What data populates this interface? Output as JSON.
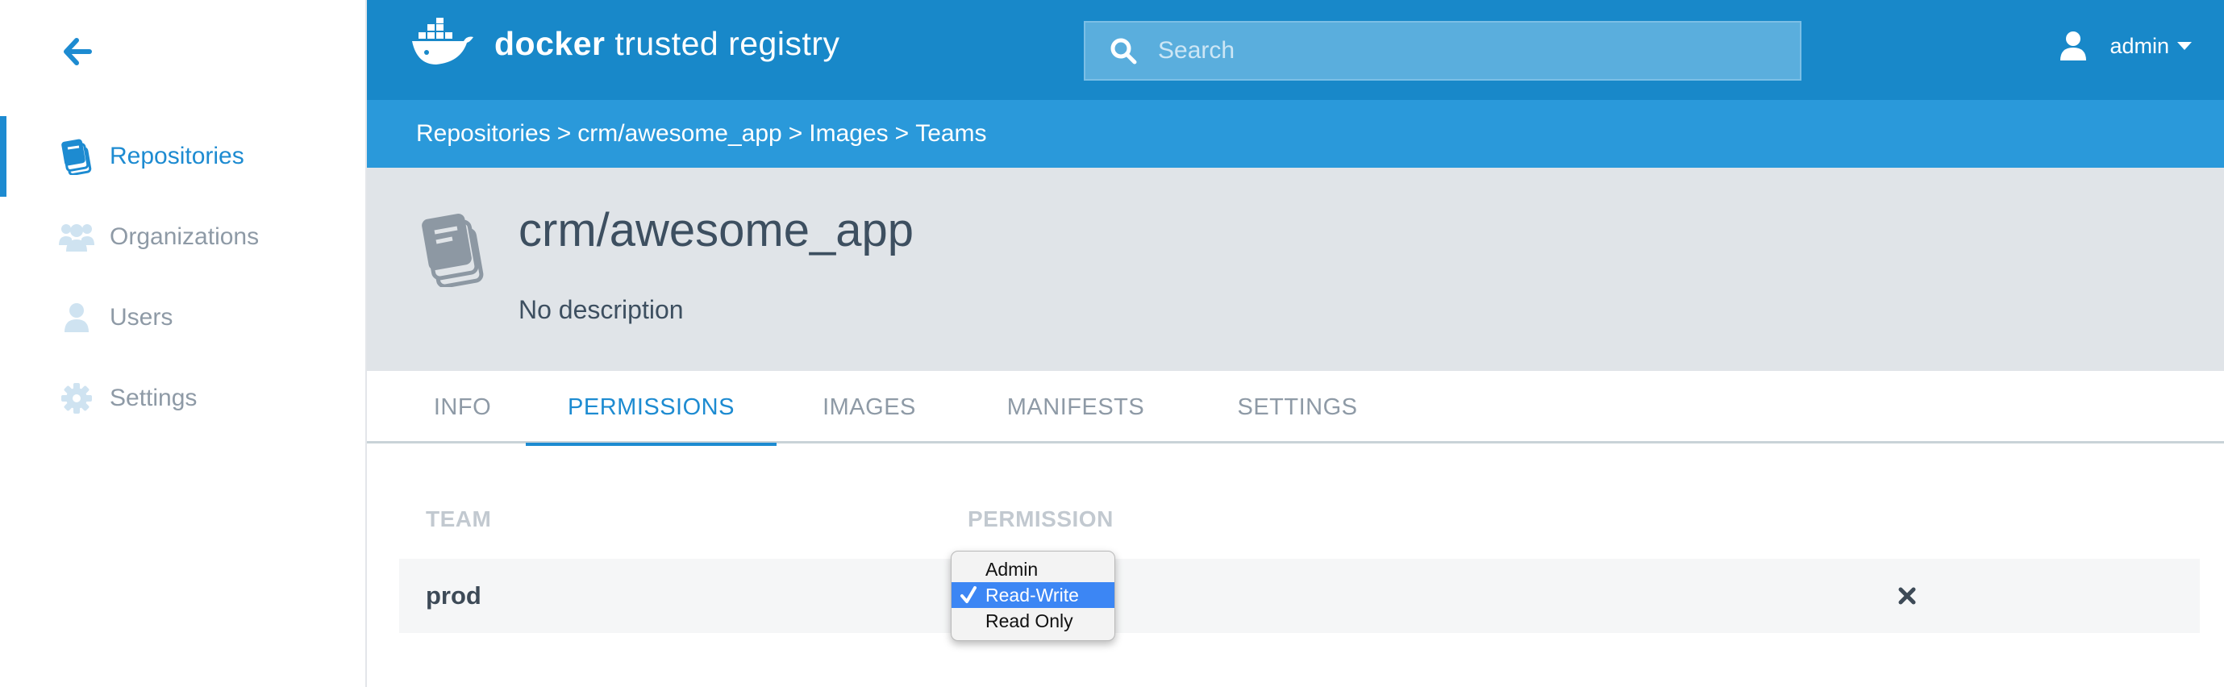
{
  "app": {
    "logo_word1": "docker",
    "logo_word2": "trusted registry"
  },
  "search": {
    "placeholder": "Search"
  },
  "user": {
    "name": "admin"
  },
  "sidebar": {
    "back_icon": "arrow-left-icon",
    "items": [
      {
        "label": "Repositories",
        "icon": "book-stack-icon",
        "active": true
      },
      {
        "label": "Organizations",
        "icon": "users-group-icon",
        "active": false
      },
      {
        "label": "Users",
        "icon": "user-icon",
        "active": false
      },
      {
        "label": "Settings",
        "icon": "gear-icon",
        "active": false
      }
    ]
  },
  "breadcrumb": [
    "Repositories",
    "crm/awesome_app",
    "Images",
    "Teams"
  ],
  "breadcrumb_separator": ">",
  "repo": {
    "title": "crm/awesome_app",
    "description": "No description"
  },
  "tabs": [
    {
      "label": "INFO",
      "active": false
    },
    {
      "label": "PERMISSIONS",
      "active": true
    },
    {
      "label": "IMAGES",
      "active": false
    },
    {
      "label": "MANIFESTS",
      "active": false
    },
    {
      "label": "SETTINGS",
      "active": false
    }
  ],
  "table": {
    "headers": {
      "team": "TEAM",
      "permission": "PERMISSION"
    },
    "rows": [
      {
        "team": "prod",
        "permission": "Read-Write"
      }
    ]
  },
  "permission_dropdown": {
    "options": [
      "Admin",
      "Read-Write",
      "Read Only"
    ],
    "selected": "Read-Write"
  },
  "colors": {
    "topbar": "#1888c9",
    "breadcrumb_bar": "#2a99da",
    "accent": "#1d8bd1",
    "header_bg": "#e0e4e8",
    "select_highlight": "#3c86f4"
  }
}
